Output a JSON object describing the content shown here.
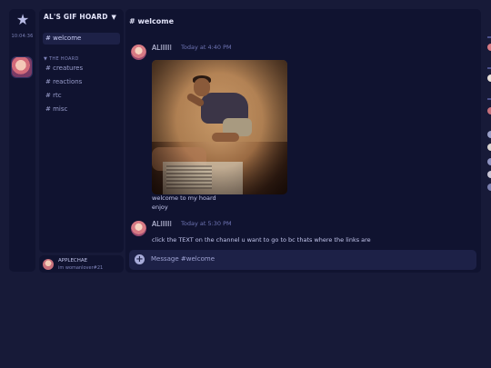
{
  "rail": {
    "time": "10:04:36",
    "home_icon": "star-icon"
  },
  "server": {
    "name": "AL'S GIF HOARD",
    "chevron": "▼"
  },
  "channels": {
    "top": [
      {
        "label": "# welcome"
      }
    ],
    "category": "▼ THE HOARD",
    "hoard": [
      {
        "label": "# creatures"
      },
      {
        "label": "# reactions"
      },
      {
        "label": "# rtc"
      },
      {
        "label": "# misc"
      }
    ]
  },
  "user": {
    "name": "APPLECHAE",
    "status": "im womanlover#21"
  },
  "chat": {
    "header": "# welcome",
    "messages": [
      {
        "author": "ALllllll",
        "time": "Today at 4:40 PM",
        "lines": [
          "welcome to my hoard",
          "enjoy"
        ]
      },
      {
        "author": "ALllllll",
        "time": "Today at 5:30 PM",
        "lines": [
          "click the TEXT on the channel u want to go to bc thats where the links are"
        ]
      }
    ],
    "input_placeholder": "Message #welcome"
  },
  "colors": {
    "background": "#171a38",
    "panel": "#101330",
    "active": "#1d2147",
    "timestamp": "#6e74b3"
  }
}
